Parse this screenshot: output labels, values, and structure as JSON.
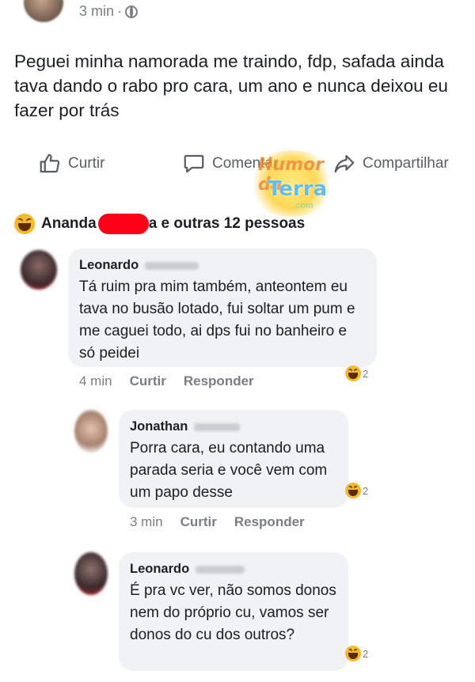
{
  "post": {
    "time": "3 min",
    "separator": "·",
    "text": "Peguei minha namorada me traindo, fdp, safada ainda tava dando o rabo pro cara, um ano e nunca deixou eu fazer por trás"
  },
  "actions": {
    "like": "Curtir",
    "comment": "Comentar",
    "share": "Compartilhar"
  },
  "watermark": {
    "line1": "Humor da",
    "line2": "Terra",
    "line3": ".com"
  },
  "reactions": {
    "name_start": "Ananda",
    "rest": "a e outras 12 pessoas"
  },
  "comments": [
    {
      "author": "Leonardo",
      "text": "Tá ruim pra mim também, anteontem eu tava no busão lotado, fui soltar um pum e me caguei todo, ai dps fui no banheiro e só peidei",
      "time": "4 min",
      "like": "Curtir",
      "reply": "Responder",
      "reaction_count": "2"
    },
    {
      "author": "Jonathan",
      "text": "Porra cara, eu contando uma parada seria e você vem com um papo desse",
      "time": "3 min",
      "like": "Curtir",
      "reply": "Responder",
      "reaction_count": "2"
    },
    {
      "author": "Leonardo",
      "text": "É pra vc ver, não somos donos nem do próprio cu, vamos ser donos do cu dos outros?",
      "reaction_count": "2"
    }
  ],
  "colors": {
    "bubble": "#f0f2f5",
    "secondary_text": "#7a7e84",
    "redaction": "#ff0016",
    "haha": "#f7b928"
  }
}
